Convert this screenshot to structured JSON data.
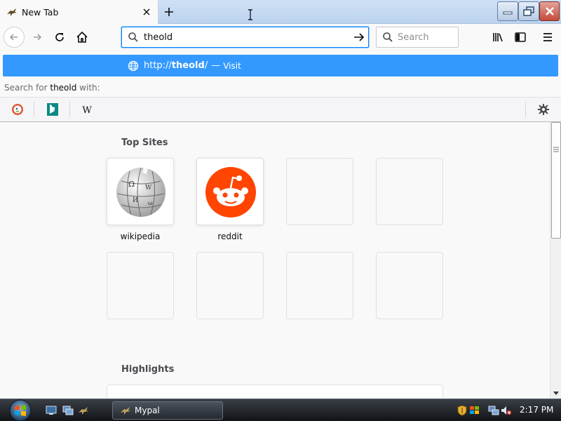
{
  "tab": {
    "title": "New Tab",
    "favicon": "mypal-bird-icon"
  },
  "toolbar": {
    "url_value": "theold",
    "search_placeholder": "Search"
  },
  "suggestion": {
    "url_prefix": "http://",
    "url_host": "theold",
    "url_suffix": "/",
    "dash": "—",
    "action": "Visit"
  },
  "search_with": {
    "prefix": "Search for ",
    "term": "theold",
    "suffix": " with:",
    "engines": [
      "DuckDuckGo",
      "Bing",
      "Wikipedia"
    ]
  },
  "topsites": {
    "heading": "Top Sites",
    "tiles": [
      {
        "label": "wikipedia",
        "icon": "wikipedia-globe-icon"
      },
      {
        "label": "reddit",
        "icon": "reddit-alien-icon"
      },
      {
        "label": ""
      },
      {
        "label": ""
      },
      {
        "label": ""
      },
      {
        "label": ""
      },
      {
        "label": ""
      },
      {
        "label": ""
      }
    ]
  },
  "highlights": {
    "heading": "Highlights"
  },
  "taskbar": {
    "window_label": "Mypal",
    "clock": "2:17 PM"
  },
  "colors": {
    "accent": "#0a84ff",
    "suggestion_bg": "#3399ff",
    "reddit": "#ff4500"
  }
}
